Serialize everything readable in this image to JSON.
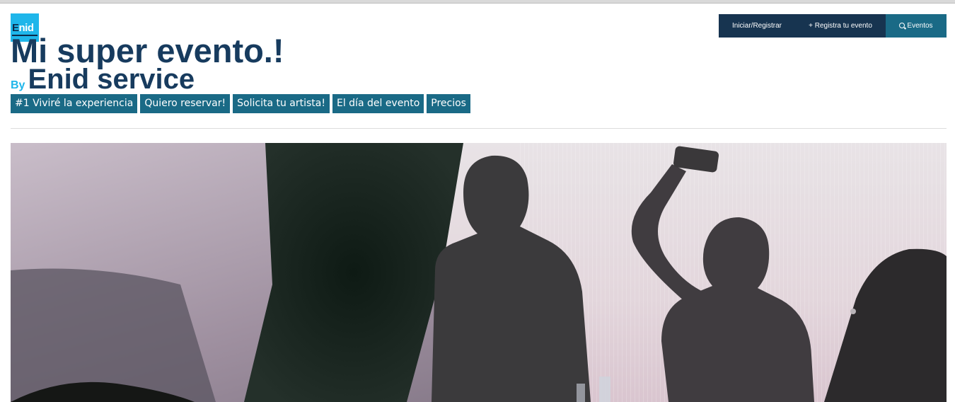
{
  "logo": {
    "text_first": "E",
    "text_rest": "nid",
    "brand_color": "#1fb6ea"
  },
  "event": {
    "title": "Mi super evento.!",
    "by_label": "By",
    "organizer": "Enid service"
  },
  "topnav": {
    "login_label": "Iniciar/Registrar",
    "register_label": "+ Registra tu evento",
    "events_label": "Eventos",
    "events_icon": "search-icon"
  },
  "tabs": [
    {
      "label": "#1 Viviré la experiencia"
    },
    {
      "label": "Quiero reservar!"
    },
    {
      "label": "Solicita tu artista!"
    },
    {
      "label": "El día del evento"
    },
    {
      "label": "Precios"
    }
  ],
  "colors": {
    "navy": "#173450",
    "teal": "#1a6a86",
    "title": "#173b5e",
    "accent": "#1fb6ea"
  },
  "hero": {
    "subject": "concert-crowd-photo"
  }
}
